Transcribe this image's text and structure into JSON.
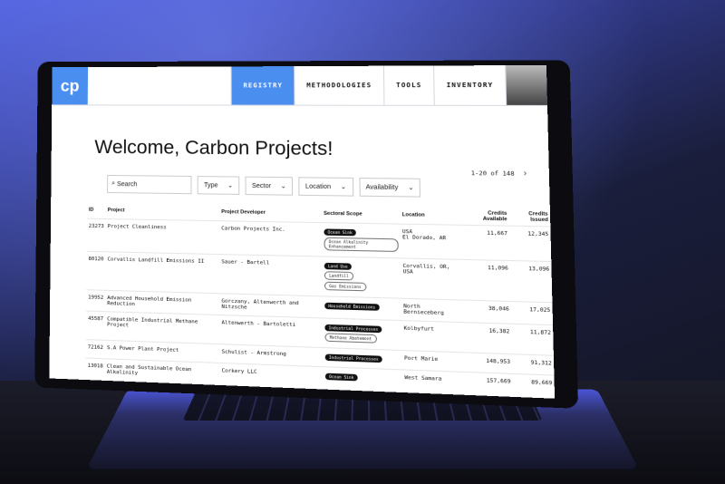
{
  "app": {
    "logo": "cp",
    "title": "Welcome, Carbon Projects!"
  },
  "nav": [
    {
      "label": "REGISTRY",
      "active": true
    },
    {
      "label": "METHODOLOGIES",
      "active": false
    },
    {
      "label": "TOOLS",
      "active": false
    },
    {
      "label": "INVENTORY",
      "active": false
    }
  ],
  "filters": {
    "search_placeholder": "Search",
    "type": "Type",
    "sector": "Sector",
    "location": "Location",
    "availability": "Availability"
  },
  "pagination": {
    "text": "1-20 of 148"
  },
  "table": {
    "headers": [
      "ID",
      "Project",
      "Project Developer",
      "Sectoral Scope",
      "Location",
      "Credits Available",
      "Credits Issued"
    ],
    "rows": [
      {
        "id": "23273",
        "project": "Project Cleanliness",
        "developer": "Carbon Projects Inc.",
        "scopes": [
          {
            "label": "Ocean Sink",
            "dark": true
          },
          {
            "label": "Ocean Alkalinity Enhancement",
            "dark": false
          }
        ],
        "location": "USA\nEl Dorado, AR",
        "available": "11,667",
        "issued": "12,345"
      },
      {
        "id": "80120",
        "project": "Corvallis Landfill Emissions II",
        "developer": "Sauer - Bartell",
        "scopes": [
          {
            "label": "Land Use",
            "dark": true
          },
          {
            "label": "Landfill",
            "dark": false
          },
          {
            "label": "Gas Emissions",
            "dark": false
          }
        ],
        "location": "Corvallis, OR, USA",
        "available": "11,096",
        "issued": "13,096"
      },
      {
        "id": "19952",
        "project": "Advanced Household Emission Reduction",
        "developer": "Gorczany, Altenwerth and Nitzsche",
        "scopes": [
          {
            "label": "Household Emissions",
            "dark": true
          }
        ],
        "location": "North Bernieceberg",
        "available": "38,046",
        "issued": "17,025"
      },
      {
        "id": "45587",
        "project": "Compatible Industrial Methane Project",
        "developer": "Altenwerth - Bartoletti",
        "scopes": [
          {
            "label": "Industrial Processes",
            "dark": true
          },
          {
            "label": "Methane Abatement",
            "dark": false
          }
        ],
        "location": "Kolbyfurt",
        "available": "16,382",
        "issued": "11,872"
      },
      {
        "id": "72162",
        "project": "S.A Power Plant Project",
        "developer": "Schulist - Armstrong",
        "scopes": [
          {
            "label": "Industrial Processes",
            "dark": true
          }
        ],
        "location": "Port Marie",
        "available": "148,953",
        "issued": "91,312"
      },
      {
        "id": "13018",
        "project": "Clean and Sustainable Ocean Alkalinity",
        "developer": "Corkery LLC",
        "scopes": [
          {
            "label": "Ocean Sink",
            "dark": true
          }
        ],
        "location": "West Samara",
        "available": "157,669",
        "issued": "89,669"
      }
    ]
  }
}
